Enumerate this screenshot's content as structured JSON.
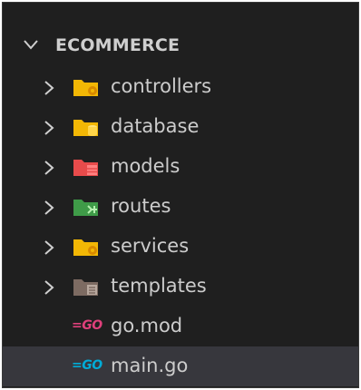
{
  "explorer": {
    "root": {
      "label": "ECOMMERCE",
      "expanded": true,
      "chevron_icon": "chevron-down-icon"
    },
    "items": [
      {
        "label": "controllers",
        "kind": "folder",
        "icon": "folder-controllers-icon",
        "color": "#f2b705",
        "badge_color": "#d98a00",
        "collapsed": true
      },
      {
        "label": "database",
        "kind": "folder",
        "icon": "folder-database-icon",
        "color": "#f2b705",
        "badge_color": "#ffd54a",
        "collapsed": true
      },
      {
        "label": "models",
        "kind": "folder",
        "icon": "folder-models-icon",
        "color": "#e84b4b",
        "badge_color": "#ff8080",
        "collapsed": true
      },
      {
        "label": "routes",
        "kind": "folder",
        "icon": "folder-routes-icon",
        "color": "#3f9b48",
        "badge_color": "#8ee08a",
        "collapsed": true
      },
      {
        "label": "services",
        "kind": "folder",
        "icon": "folder-services-icon",
        "color": "#f2b705",
        "badge_color": "#d98a00",
        "collapsed": true
      },
      {
        "label": "templates",
        "kind": "folder",
        "icon": "folder-templates-icon",
        "color": "#7d6b62",
        "badge_color": "#b8a89e",
        "collapsed": true
      },
      {
        "label": "go.mod",
        "kind": "file",
        "icon": "go-mod-icon",
        "icon_text": "=GO",
        "color": "#e0407b"
      },
      {
        "label": "main.go",
        "kind": "file",
        "icon": "go-file-icon",
        "icon_text": "=GO",
        "color": "#00acd7",
        "selected": true
      }
    ]
  },
  "colors": {
    "background": "#1f1f1f",
    "text": "#cccccc",
    "selection": "#37373d"
  }
}
